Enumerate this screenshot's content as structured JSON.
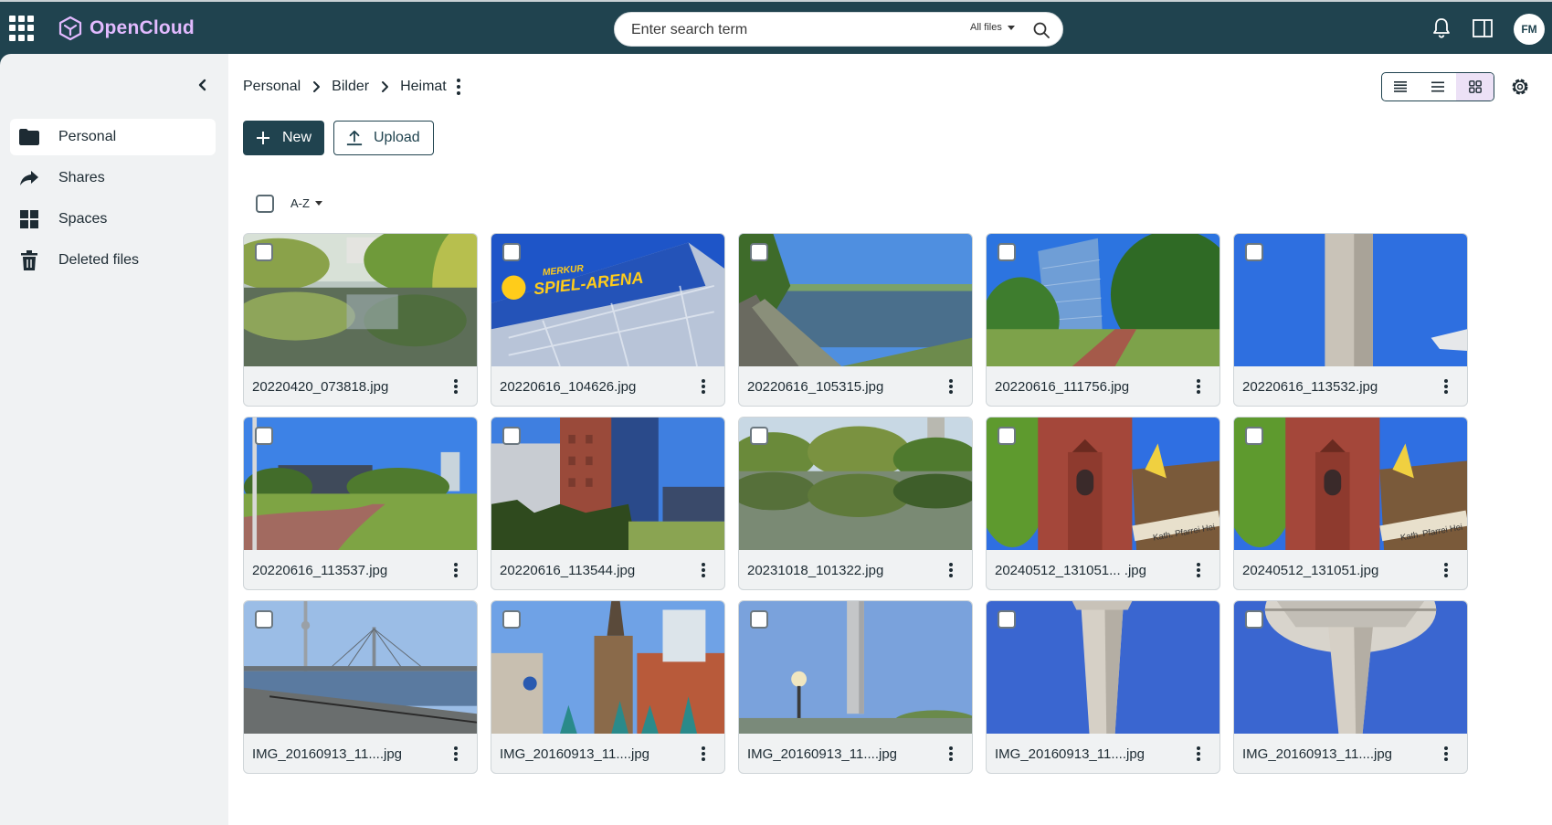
{
  "header": {
    "app_name": "OpenCloud",
    "search_placeholder": "Enter search term",
    "search_scope": "All files",
    "user_initials": "FM"
  },
  "sidebar": {
    "items": [
      {
        "label": "Personal",
        "icon": "folder-icon",
        "active": true
      },
      {
        "label": "Shares",
        "icon": "share-icon",
        "active": false
      },
      {
        "label": "Spaces",
        "icon": "spaces-grid-icon",
        "active": false
      },
      {
        "label": "Deleted files",
        "icon": "trash-icon",
        "active": false
      }
    ]
  },
  "breadcrumb": [
    "Personal",
    "Bilder",
    "Heimat"
  ],
  "actions": {
    "new_label": "New",
    "upload_label": "Upload"
  },
  "sort": {
    "label": "A-Z"
  },
  "view_mode": "tiles",
  "colors": {
    "topbar": "#20434f",
    "brand": "#e2baff",
    "active_view": "#ece1f6"
  },
  "files": [
    {
      "name": "20220420_073818.jpg",
      "scene": "pond"
    },
    {
      "name": "20220616_104626.jpg",
      "scene": "arena",
      "sign_line1": "MERKUR",
      "sign_line2": "SPIEL-ARENA"
    },
    {
      "name": "20220616_105315.jpg",
      "scene": "river"
    },
    {
      "name": "20220616_111756.jpg",
      "scene": "glass-building"
    },
    {
      "name": "20220616_113532.jpg",
      "scene": "tower-column"
    },
    {
      "name": "20220616_113537.jpg",
      "scene": "park"
    },
    {
      "name": "20220616_113544.jpg",
      "scene": "brick-building"
    },
    {
      "name": "20231018_101322.jpg",
      "scene": "lake"
    },
    {
      "name": "20240512_131051... .jpg",
      "scene": "church",
      "sign_text": "Kath. Pfarrei Hei"
    },
    {
      "name": "20240512_131051.jpg",
      "scene": "church",
      "sign_text": "Kath. Pfarrei Hei"
    },
    {
      "name": "IMG_20160913_11....jpg",
      "scene": "bridge"
    },
    {
      "name": "IMG_20160913_11....jpg",
      "scene": "old-town"
    },
    {
      "name": "IMG_20160913_11....jpg",
      "scene": "tv-tower"
    },
    {
      "name": "IMG_20160913_11....jpg",
      "scene": "tower-up"
    },
    {
      "name": "IMG_20160913_11....jpg",
      "scene": "tower-up2"
    }
  ]
}
